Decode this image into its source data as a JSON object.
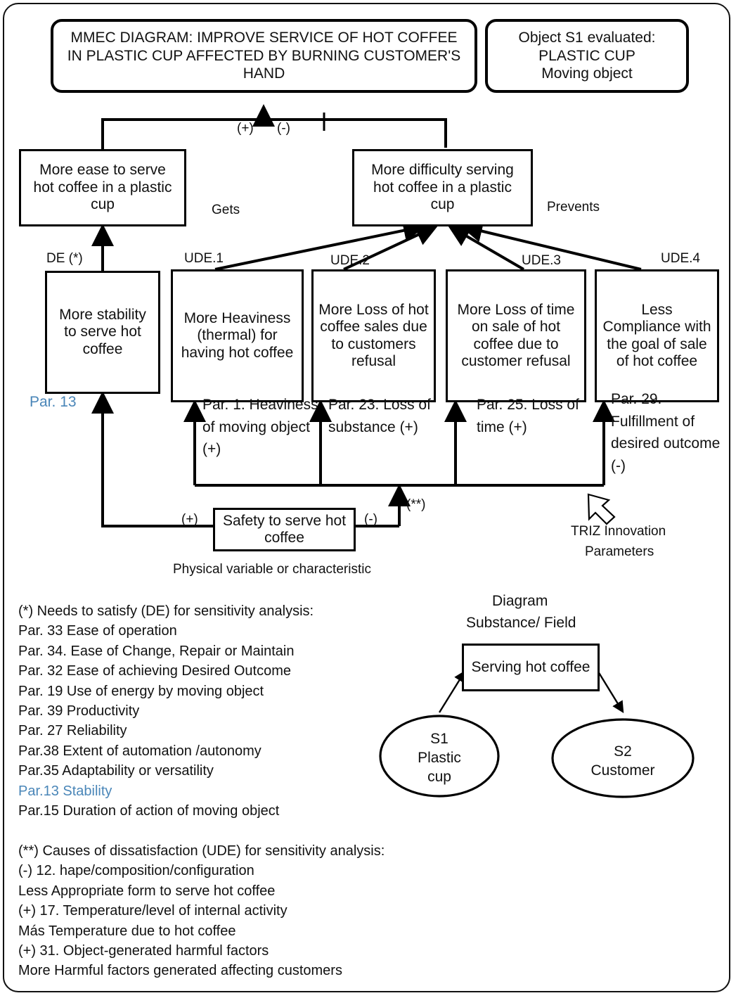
{
  "title_box": {
    "text": "MMEC DIAGRAM: IMPROVE SERVICE OF HOT COFFEE IN PLASTIC CUP AFFECTED BY BURNING CUSTOMER'S HAND"
  },
  "object_box": {
    "line1": "Object S1 evaluated:",
    "line2": "PLASTIC CUP",
    "line3": "Moving object"
  },
  "polarity": {
    "plus": "(+)",
    "minus": "(-)"
  },
  "de_box": {
    "text": "More ease to serve hot coffee in a plastic cup"
  },
  "ude_root_box": {
    "text": "More difficulty serving hot coffee in a plastic cup"
  },
  "relations": {
    "gets": "Gets",
    "prevents": "Prevents"
  },
  "tags": {
    "de": "DE (*)",
    "ude1": "UDE.1",
    "ude2": "UDE.2",
    "ude3": "UDE.3",
    "ude4": "UDE.4"
  },
  "effect_boxes": [
    {
      "name": "stability",
      "text": "More stability to serve hot coffee"
    },
    {
      "name": "heaviness",
      "text": "More Heaviness (thermal) for having hot coffee"
    },
    {
      "name": "loss-of-sales",
      "text": "More Loss of hot coffee sales due to customers refusal"
    },
    {
      "name": "loss-of-time",
      "text": "More Loss of time on sale of hot coffee due to customer refusal"
    },
    {
      "name": "less-compliance",
      "text": "Less Compliance with the goal of sale of hot coffee"
    }
  ],
  "parameters": {
    "stability": "Par. 13",
    "heaviness": "Par. 1. Heaviness of moving object (+)",
    "sales": "Par. 23. Loss of substance (+)",
    "time": "Par. 25. Loss of time (+)",
    "compliance": "Par. 29. Fulfillment of desired outcome (-)"
  },
  "safety_box": {
    "text": "Safety to serve hot coffee"
  },
  "safety_signs": {
    "left": "(+)",
    "right": "(-)",
    "note": "(**)"
  },
  "captions": {
    "physical_variable": "Physical variable  or characteristic",
    "triz_line1": "TRIZ Innovation",
    "triz_line2": "Parameters"
  },
  "de_list": {
    "heading": "(*) Needs to satisfy (DE) for sensitivity analysis:",
    "items": [
      {
        "text": "Par. 33 Ease of operation",
        "highlight": false
      },
      {
        "text": "Par. 34. Ease of Change, Repair or Maintain",
        "highlight": false
      },
      {
        "text": "Par. 32 Ease of achieving  Desired Outcome",
        "highlight": false
      },
      {
        "text": "Par. 19 Use of energy by moving object",
        "highlight": false
      },
      {
        "text": "Par. 39 Productivity",
        "highlight": false
      },
      {
        "text": "Par. 27  Reliability",
        "highlight": false
      },
      {
        "text": "Par.38 Extent of automation /autonomy",
        "highlight": false
      },
      {
        "text": "Par.35  Adaptability or versatility",
        "highlight": false
      },
      {
        "text": "Par.13 Stability",
        "highlight": true
      },
      {
        "text": "Par.15 Duration of action of moving object",
        "highlight": false
      }
    ]
  },
  "ude_list": {
    "heading": "(**) Causes of dissatisfaction (UDE) for sensitivity analysis:",
    "items": [
      {
        "text": "(-) 12. hape/composition/configuration"
      },
      {
        "text": "Less Appropriate form to serve hot coffee"
      },
      {
        "text": "(+) 17. Temperature/level of internal activity"
      },
      {
        "text": "Más Temperature due to hot coffee"
      },
      {
        "text": "(+) 31. Object-generated harmful factors"
      },
      {
        "text": "More Harmful factors generated affecting customers"
      }
    ]
  },
  "su_field": {
    "title_line1": "Diagram",
    "title_line2": "Substance/ Field",
    "field_box": "Serving hot coffee",
    "s1_line1": "S1",
    "s1_line2": "Plastic",
    "s1_line3": "cup",
    "s2_line1": "S2",
    "s2_line2": "Customer"
  },
  "colors": {
    "highlight": "#4A86B8",
    "stroke": "#000000",
    "background": "#FFFFFF"
  }
}
